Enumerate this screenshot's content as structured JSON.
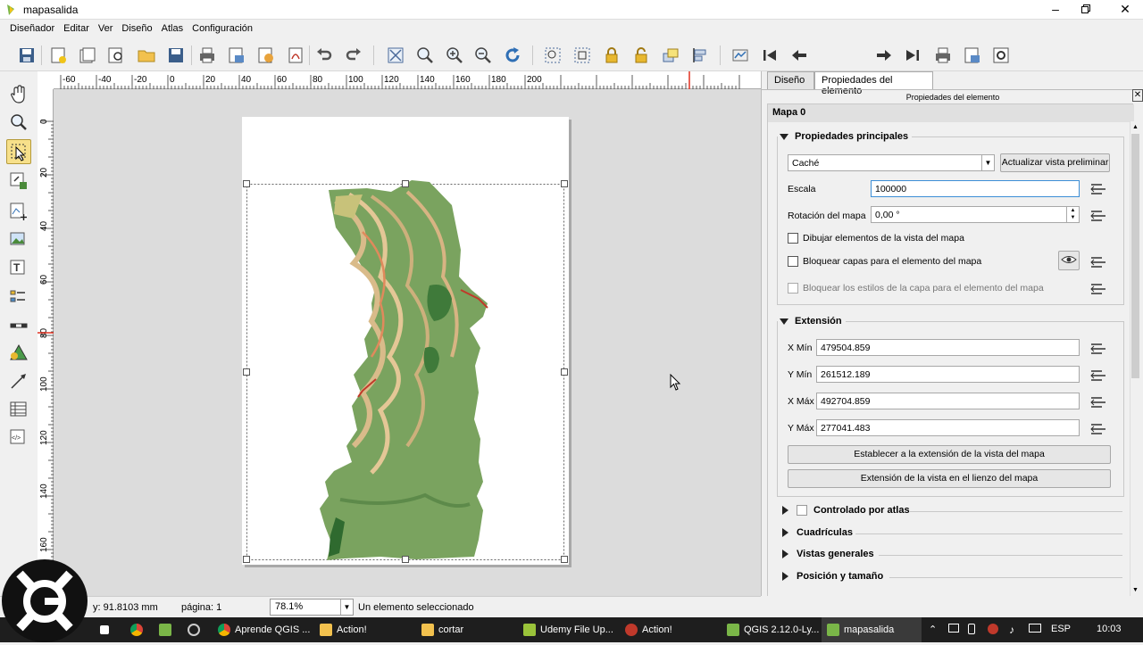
{
  "window": {
    "title": "mapasalida"
  },
  "menu": [
    "Diseñador",
    "Editar",
    "Ver",
    "Diseño",
    "Atlas",
    "Configuración"
  ],
  "toolbar": {
    "page_value": "1"
  },
  "ruler": {
    "top_labels": [
      "-60",
      "-40",
      "-20",
      "0",
      "20",
      "40",
      "60",
      "80",
      "100",
      "120",
      "140",
      "160",
      "180",
      "200"
    ],
    "left_labels": [
      "0",
      "20",
      "40",
      "60",
      "80",
      "100",
      "120",
      "140",
      "160"
    ]
  },
  "status": {
    "y": "y: 91.8103 mm",
    "page": "página: 1",
    "zoom": "78.1%",
    "selection": "Un elemento seleccionado"
  },
  "panel": {
    "tabs": [
      "Diseño",
      "Propiedades del elemento"
    ],
    "title": "Propiedades del elemento",
    "item_name": "Mapa 0",
    "main": {
      "header": "Propiedades principales",
      "cache": "Caché",
      "update_btn": "Actualizar vista preliminar",
      "scale_label": "Escala",
      "scale_value": "100000",
      "rotation_label": "Rotación del mapa",
      "rotation_value": "0,00 °",
      "draw_items": "Dibujar elementos de la vista del mapa",
      "lock_layers": "Bloquear capas para el elemento del mapa",
      "lock_styles": "Bloquear los estilos de la capa para el elemento del mapa"
    },
    "extent": {
      "header": "Extensión",
      "xmin_label": "X Mín",
      "xmin": "479504.859",
      "ymin_label": "Y Mín",
      "ymin": "261512.189",
      "xmax_label": "X Máx",
      "xmax": "492704.859",
      "ymax_label": "Y Máx",
      "ymax": "277041.483",
      "btn1": "Establecer a la extensión de la vista del mapa",
      "btn2": "Extensión de la vista en el lienzo del mapa"
    },
    "collapsed": [
      "Controlado por atlas",
      "Cuadrículas",
      "Vistas generales",
      "Posición y tamaño"
    ]
  },
  "taskbar": {
    "items": [
      "Aprende QGIS ...",
      "Action!",
      "cortar",
      "Udemy File Up...",
      "Action!",
      "QGIS 2.12.0-Ly...",
      "mapasalida"
    ],
    "lang": "ESP",
    "time": "10:03"
  },
  "colors": {
    "map_green": "#6f9a5f",
    "map_dark": "#3f7a3a",
    "map_tan": "#d2b48c",
    "map_orange": "#e49060",
    "highlight": "#f7e08a"
  }
}
